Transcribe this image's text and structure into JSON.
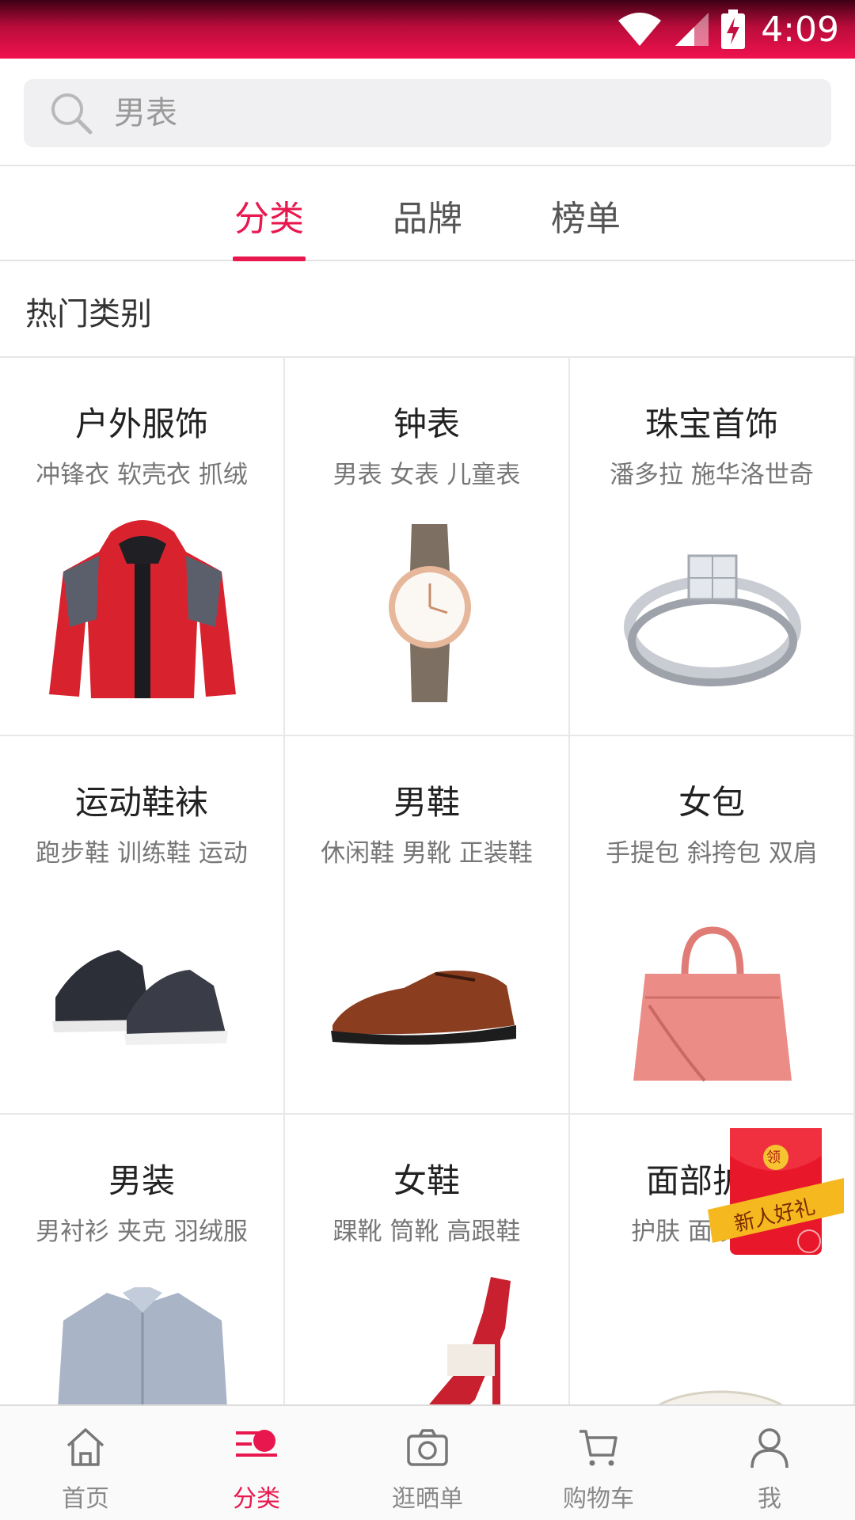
{
  "status_bar": {
    "time": "4:09"
  },
  "search": {
    "placeholder": "男表"
  },
  "tabs": [
    {
      "label": "分类",
      "active": true
    },
    {
      "label": "品牌",
      "active": false
    },
    {
      "label": "榜单",
      "active": false
    }
  ],
  "section": {
    "title": "热门类别"
  },
  "categories": [
    {
      "title": "户外服饰",
      "subtitle": "冲锋衣 软壳衣 抓绒",
      "icon": "jacket-image"
    },
    {
      "title": "钟表",
      "subtitle": "男表 女表 儿童表",
      "icon": "watch-image"
    },
    {
      "title": "珠宝首饰",
      "subtitle": "潘多拉 施华洛世奇",
      "icon": "ring-image"
    },
    {
      "title": "运动鞋袜",
      "subtitle": "跑步鞋 训练鞋 运动",
      "icon": "sneakers-image"
    },
    {
      "title": "男鞋",
      "subtitle": "休闲鞋 男靴 正装鞋",
      "icon": "dress-shoe-image"
    },
    {
      "title": "女包",
      "subtitle": "手提包 斜挎包 双肩",
      "icon": "handbag-image"
    },
    {
      "title": "男装",
      "subtitle": "男衬衫 夹克 羽绒服",
      "icon": "shirt-image"
    },
    {
      "title": "女鞋",
      "subtitle": "踝靴 筒靴 高跟鞋",
      "icon": "high-heel-image"
    },
    {
      "title": "面部护",
      "subtitle": "护肤 面膜",
      "icon": "cream-jar-image"
    }
  ],
  "promo": {
    "badge": "领",
    "label": "新人好礼"
  },
  "bottom_nav": [
    {
      "label": "首页",
      "icon": "home-icon",
      "active": false
    },
    {
      "label": "分类",
      "icon": "category-icon",
      "active": true
    },
    {
      "label": "逛晒单",
      "icon": "camera-icon",
      "active": false
    },
    {
      "label": "购物车",
      "icon": "cart-icon",
      "active": false
    },
    {
      "label": "我",
      "icon": "profile-icon",
      "active": false
    }
  ],
  "colors": {
    "accent": "#e8184f",
    "status_bar": "#f0124f"
  }
}
